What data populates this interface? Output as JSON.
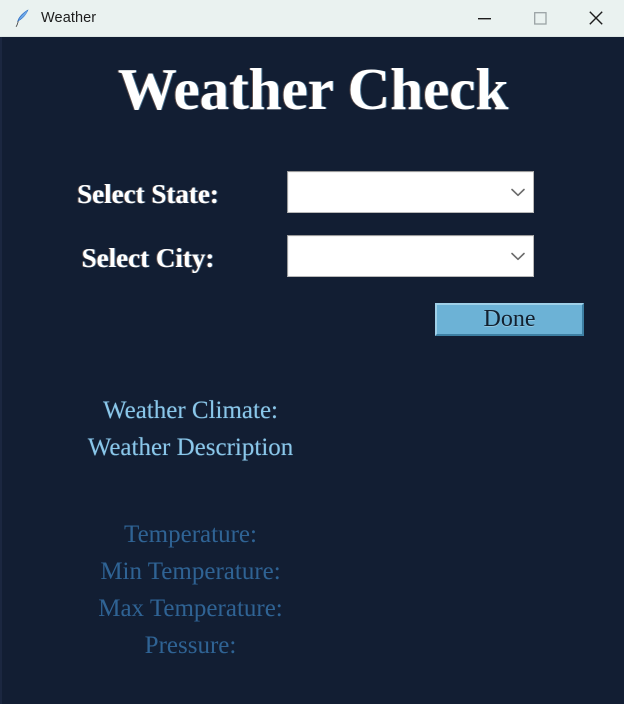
{
  "window": {
    "title": "Weather",
    "icon": "feather-quill-icon",
    "controls": [
      {
        "name": "minimize",
        "glyph": "minimize-icon"
      },
      {
        "name": "maximize",
        "glyph": "maximize-icon"
      },
      {
        "name": "close",
        "glyph": "close-icon"
      }
    ]
  },
  "colors": {
    "titlebar_bg": "#eaf2f0",
    "window_bg": "#121e33",
    "heading_text": "#ffffff",
    "label_text": "#ffffff",
    "button_bg": "#6cb2d6",
    "button_text": "#12202f",
    "result_primary": "#8ac7ea",
    "result_secondary": "#2f6394",
    "combobox_bg": "#ffffff"
  },
  "main": {
    "heading": "Weather Check",
    "form": {
      "state": {
        "label": "Select State:",
        "value": "",
        "placeholder": ""
      },
      "city": {
        "label": "Select City:",
        "value": "",
        "placeholder": ""
      }
    },
    "submit_button": "Done",
    "results": {
      "climate": "Weather Climate:",
      "description": "Weather Description",
      "temperature": "Temperature:",
      "min_temperature": "Min Temperature:",
      "max_temperature": "Max Temperature:",
      "pressure": "Pressure:"
    }
  }
}
